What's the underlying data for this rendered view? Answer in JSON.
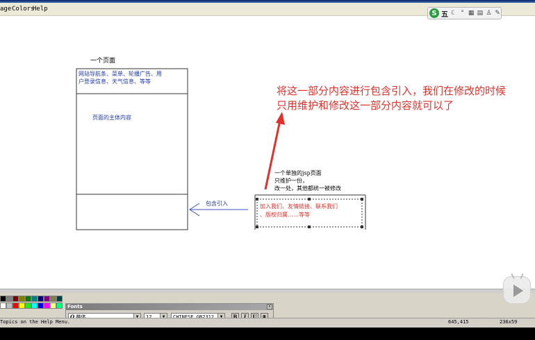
{
  "window": {
    "menu": [
      "age",
      "Colors",
      "Help"
    ]
  },
  "ime_toolbar": {
    "logo": "S",
    "mode": "五",
    "icons": [
      "moon-icon",
      "dot-icon",
      "keyboard-icon",
      "clipboard-icon",
      "person-icon",
      "wrench-icon"
    ]
  },
  "drawing": {
    "page_label": "一个页面",
    "header_text_line1": "网站导航条、菜单、轮播广告、用",
    "header_text_line2": "户登录信息、天气信息、等等",
    "main_text": "页面的主体内容",
    "annotation_line1": "将这一部分内容进行包含引入，我们在修改的时候",
    "annotation_line2": "只用维护和修改这一部分内容就可以了",
    "jsp_title": "一个单独的jsp页面",
    "jsp_line1": "只维护一份，",
    "jsp_line2": "改一处，其他都统一被修改",
    "include_label": "包含引入",
    "footer_text_line1": "加入我们、友情链接、联系我们",
    "footer_text_line2": "、版权归属……等等"
  },
  "fonts_toolbar": {
    "title": "Fonts",
    "font_name": "楷体",
    "font_size": "12",
    "charset": "CHINESE_GB2312",
    "bold": "B",
    "italic": "I",
    "underline": "U"
  },
  "status": {
    "help_text": "Topics on the Help Menu.",
    "coords": "645,415",
    "size": "236x59"
  },
  "colors": {
    "red_text": "#e0302a",
    "blue_text": "#1f3aa8",
    "arrow_blue": "#3b4fc0",
    "accent_green": "#2a9d3e"
  },
  "palette": [
    "#000000",
    "#808080",
    "#800000",
    "#808000",
    "#008000",
    "#008080",
    "#000080",
    "#800080",
    "#808040",
    "#004040",
    "#ffffff",
    "#c0c0c0",
    "#ff0000",
    "#ffff00",
    "#00ff00",
    "#00ffff",
    "#0000ff",
    "#ff00ff",
    "#ffff80",
    "#00ff80"
  ]
}
